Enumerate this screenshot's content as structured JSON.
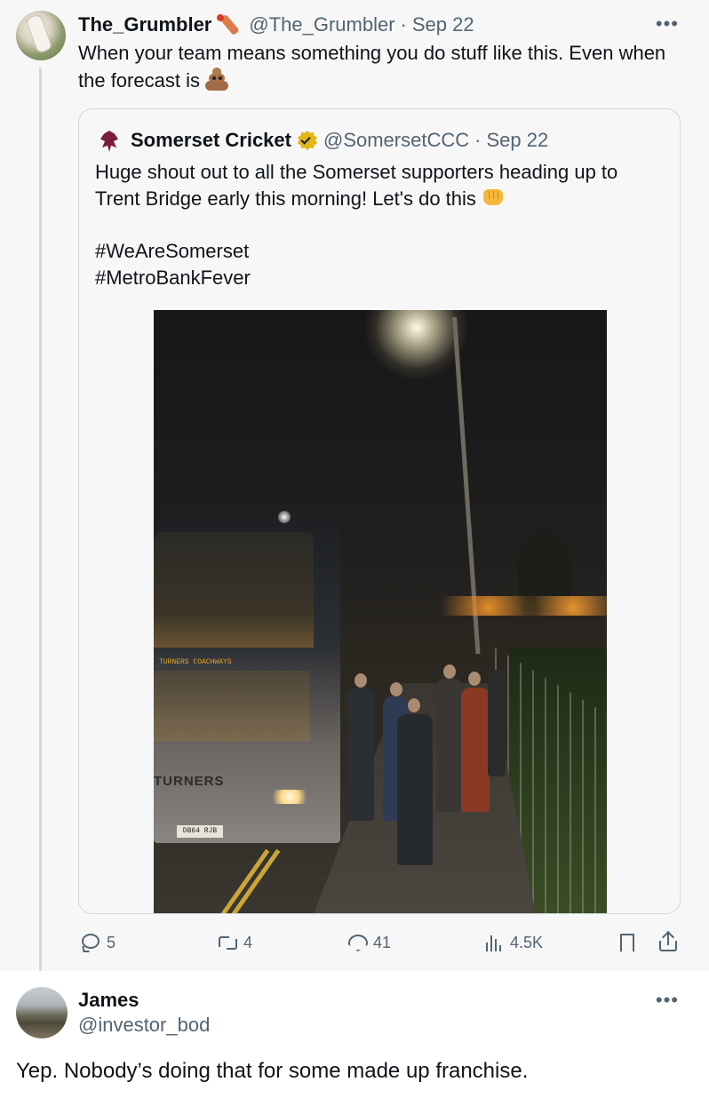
{
  "main_tweet": {
    "author_name": "The_Grumbler",
    "author_handle": "@The_Grumbler",
    "separator": "·",
    "date": "Sep 22",
    "text": "When your team means something you do stuff like this. Even when the forecast is",
    "more": "•••",
    "emoji_icons": [
      "cricket-bat-icon",
      "pile-of-poo-icon"
    ]
  },
  "quoted_tweet": {
    "author_name": "Somerset Cricket",
    "author_handle": "@SomersetCCC",
    "separator": "·",
    "date": "Sep 22",
    "line1": "Huge shout out to all the Somerset supporters heading up to Trent Bridge early this morning! Let's do this",
    "hashtag1": "#WeAreSomerset",
    "hashtag2": "#MetroBankFever",
    "verified": true,
    "photo": {
      "bus_sign": "TURNERS COACHWAYS",
      "bus_brand": "TURNERS",
      "plate": "DB64 RJB"
    }
  },
  "actions": {
    "replies": "5",
    "retweets": "4",
    "likes": "41",
    "views": "4.5K"
  },
  "reply": {
    "author_name": "James",
    "author_handle": "@investor_bod",
    "more": "•••",
    "text": "Yep. Nobody’s doing that for some made up franchise."
  },
  "colors": {
    "text": "#0f1419",
    "secondary": "#536471",
    "border": "#cfd9de",
    "background_highlight": "#f7f7f7",
    "verified_gold": "#e2b719"
  }
}
